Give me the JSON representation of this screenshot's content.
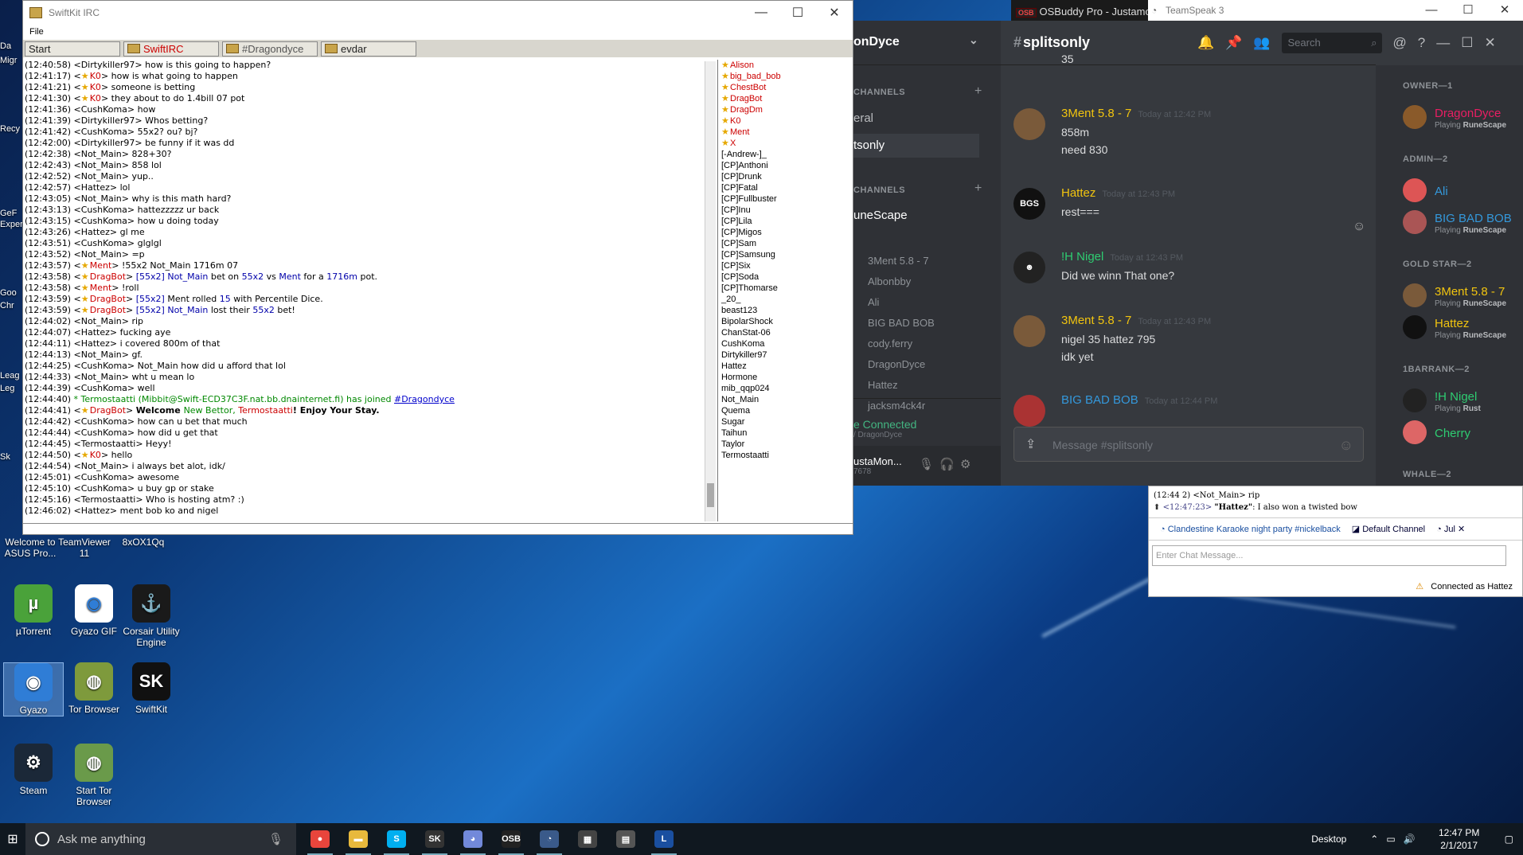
{
  "desktop": {
    "icons": [
      {
        "name": "µTorrent",
        "glyph": "µ",
        "color": "#4aa23a"
      },
      {
        "name": "Gyazo GIF",
        "glyph": "◉",
        "color": "#ffffff"
      },
      {
        "name": "Corsair Utility Engine",
        "glyph": "⚓",
        "color": "#1a1a1a"
      },
      {
        "name": "Gyazo",
        "glyph": "◉",
        "color": "#2f7dd6"
      },
      {
        "name": "Tor Browser",
        "glyph": "◍",
        "color": "#7e9a3c"
      },
      {
        "name": "SwiftKit",
        "glyph": "SK",
        "color": "#111111"
      },
      {
        "name": "Steam",
        "glyph": "⚙",
        "color": "#1b2838"
      },
      {
        "name": "Start Tor Browser",
        "glyph": "◍",
        "color": "#6a9a4a"
      }
    ],
    "top_icons": [
      "Welcome to ASUS Pro...",
      "TeamViewer 11",
      "8xOX1Qq"
    ],
    "edge_labels": [
      "Da",
      "Migr",
      "Recy",
      "GeF",
      "Exper",
      "Goo",
      "Chr",
      "Leag",
      "Leg",
      "Sk"
    ]
  },
  "irc": {
    "title": "SwiftKit IRC",
    "menu": "File",
    "tabs": [
      "Start",
      "SwiftIRC",
      "#Dragondyce",
      "evdar"
    ],
    "lines": [
      {
        "t": "(12:40:58)",
        "parts": [
          {
            "s": "<Dirtykiller97> how is this going to happen?"
          }
        ]
      },
      {
        "t": "(12:41:17)",
        "parts": [
          {
            "s": "<"
          },
          {
            "star": true
          },
          {
            "s": "K0",
            "c": "red"
          },
          {
            "s": "> how is what going to happen"
          }
        ]
      },
      {
        "t": "(12:41:21)",
        "parts": [
          {
            "s": "<"
          },
          {
            "star": true
          },
          {
            "s": "K0",
            "c": "red"
          },
          {
            "s": "> someone is betting"
          }
        ]
      },
      {
        "t": "(12:41:30)",
        "parts": [
          {
            "s": "<"
          },
          {
            "star": true
          },
          {
            "s": "K0",
            "c": "red"
          },
          {
            "s": "> they about to do 1.4bill 07 pot"
          }
        ]
      },
      {
        "t": "(12:41:36)",
        "parts": [
          {
            "s": "<CushKoma> how"
          }
        ]
      },
      {
        "t": "(12:41:39)",
        "parts": [
          {
            "s": "<Dirtykiller97> Whos betting?"
          }
        ]
      },
      {
        "t": "(12:41:42)",
        "parts": [
          {
            "s": "<CushKoma> 55x2? ou? bj?"
          }
        ]
      },
      {
        "t": "(12:42:00)",
        "parts": [
          {
            "s": "<Dirtykiller97> be funny if it was dd"
          }
        ]
      },
      {
        "t": "(12:42:38)",
        "parts": [
          {
            "s": "<Not_Main> 828+30?"
          }
        ]
      },
      {
        "t": "(12:42:43)",
        "parts": [
          {
            "s": "<Not_Main> 858 lol"
          }
        ]
      },
      {
        "t": "(12:42:52)",
        "parts": [
          {
            "s": "<Not_Main> yup.."
          }
        ]
      },
      {
        "t": "(12:42:57)",
        "parts": [
          {
            "s": "<Hattez> lol"
          }
        ]
      },
      {
        "t": "(12:43:05)",
        "parts": [
          {
            "s": "<Not_Main> why is this math hard?"
          }
        ]
      },
      {
        "t": "(12:43:13)",
        "parts": [
          {
            "s": "<CushKoma> hattezzzzz ur back"
          }
        ]
      },
      {
        "t": "(12:43:15)",
        "parts": [
          {
            "s": "<CushKoma> how u doing today"
          }
        ]
      },
      {
        "t": "(12:43:26)",
        "parts": [
          {
            "s": "<Hattez> gl me"
          }
        ]
      },
      {
        "t": "(12:43:51)",
        "parts": [
          {
            "s": "<CushKoma> glglgl"
          }
        ]
      },
      {
        "t": "(12:43:52)",
        "parts": [
          {
            "s": "<Not_Main> =p"
          }
        ]
      },
      {
        "t": "(12:43:57)",
        "parts": [
          {
            "s": "<"
          },
          {
            "star": true
          },
          {
            "s": "Ment",
            "c": "red"
          },
          {
            "s": "> !55x2 Not_Main 1716m 07"
          }
        ]
      },
      {
        "t": "(12:43:58)",
        "parts": [
          {
            "s": "<"
          },
          {
            "star": true
          },
          {
            "s": "DragBot",
            "c": "red"
          },
          {
            "s": "> "
          },
          {
            "s": "[55x2]",
            "c": "blue"
          },
          {
            "s": " "
          },
          {
            "s": "Not_Main",
            "c": "blue"
          },
          {
            "s": " bet on "
          },
          {
            "s": "55x2",
            "c": "blue"
          },
          {
            "s": " vs "
          },
          {
            "s": "Ment",
            "c": "blue"
          },
          {
            "s": " for a "
          },
          {
            "s": "1716m",
            "c": "blue"
          },
          {
            "s": " pot."
          }
        ]
      },
      {
        "t": "(12:43:58)",
        "parts": [
          {
            "s": "<"
          },
          {
            "star": true
          },
          {
            "s": "Ment",
            "c": "red"
          },
          {
            "s": "> !roll"
          }
        ]
      },
      {
        "t": "(12:43:59)",
        "parts": [
          {
            "s": "<"
          },
          {
            "star": true
          },
          {
            "s": "DragBot",
            "c": "red"
          },
          {
            "s": "> "
          },
          {
            "s": "[55x2]",
            "c": "blue"
          },
          {
            "s": " Ment rolled "
          },
          {
            "s": "15",
            "c": "blue"
          },
          {
            "s": " with Percentile Dice."
          }
        ]
      },
      {
        "t": "(12:43:59)",
        "parts": [
          {
            "s": "<"
          },
          {
            "star": true
          },
          {
            "s": "DragBot",
            "c": "red"
          },
          {
            "s": "> "
          },
          {
            "s": "[55x2]",
            "c": "blue"
          },
          {
            "s": " "
          },
          {
            "s": "Not_Main",
            "c": "blue"
          },
          {
            "s": " lost their "
          },
          {
            "s": "55x2",
            "c": "blue"
          },
          {
            "s": " bet!"
          }
        ]
      },
      {
        "t": "(12:44:02)",
        "parts": [
          {
            "s": "<Not_Main> rip"
          }
        ]
      },
      {
        "t": "(12:44:07)",
        "parts": [
          {
            "s": "<Hattez> fucking aye"
          }
        ]
      },
      {
        "t": "(12:44:11)",
        "parts": [
          {
            "s": "<Hattez> i covered 800m of that"
          }
        ]
      },
      {
        "t": "(12:44:13)",
        "parts": [
          {
            "s": "<Not_Main> gf."
          }
        ]
      },
      {
        "t": "(12:44:25)",
        "parts": [
          {
            "s": "<CushKoma> Not_Main how did u afford that lol"
          }
        ]
      },
      {
        "t": "(12:44:33)",
        "parts": [
          {
            "s": "<Not_Main> wht u mean lo"
          }
        ]
      },
      {
        "t": "(12:44:39)",
        "parts": [
          {
            "s": "<CushKoma> well"
          }
        ]
      },
      {
        "t": "(12:44:40)",
        "c": "grn",
        "parts": [
          {
            "s": "* Termostaatti (Mibbit@Swift-ECD37C3F.nat.bb.dnainternet.fi) has joined ",
            "c": "grn"
          },
          {
            "s": "#Dragondyce",
            "c": "lnk"
          }
        ]
      },
      {
        "t": "(12:44:41)",
        "parts": [
          {
            "s": "<"
          },
          {
            "star": true
          },
          {
            "s": "DragBot",
            "c": "red"
          },
          {
            "s": "> "
          },
          {
            "s": "Welcome ",
            "c": "bold"
          },
          {
            "s": "New Bettor, ",
            "c": "grn"
          },
          {
            "s": "Termostaatti",
            "c": "red"
          },
          {
            "s": "! Enjoy Your Stay.",
            "c": "bold"
          }
        ]
      },
      {
        "t": "(12:44:42)",
        "parts": [
          {
            "s": "<CushKoma> how can u bet that much"
          }
        ]
      },
      {
        "t": "(12:44:44)",
        "parts": [
          {
            "s": "<CushKoma> how did u get that"
          }
        ]
      },
      {
        "t": "(12:44:45)",
        "parts": [
          {
            "s": "<Termostaatti> Heyy!"
          }
        ]
      },
      {
        "t": "(12:44:50)",
        "parts": [
          {
            "s": "<"
          },
          {
            "star": true
          },
          {
            "s": "K0",
            "c": "red"
          },
          {
            "s": ">  hello"
          }
        ]
      },
      {
        "t": "(12:44:54)",
        "parts": [
          {
            "s": "<Not_Main> i always bet alot, idk/"
          }
        ]
      },
      {
        "t": "(12:45:01)",
        "parts": [
          {
            "s": "<CushKoma> awesome"
          }
        ]
      },
      {
        "t": "(12:45:10)",
        "parts": [
          {
            "s": "<CushKoma> u buy gp or stake"
          }
        ]
      },
      {
        "t": "(12:45:16)",
        "parts": [
          {
            "s": "<Termostaatti> Who is hosting atm? :)"
          }
        ]
      },
      {
        "t": "(12:46:02)",
        "parts": [
          {
            "s": "<Hattez> ment bob ko and nigel"
          }
        ]
      }
    ],
    "nicks_ops": [
      "Alison",
      "big_bad_bob",
      "ChestBot",
      "DragBot",
      "DragDm",
      "K0",
      "Ment",
      "X"
    ],
    "nicks": [
      "[-Andrew-]_",
      "[CP]Anthoni",
      "[CP]Drunk",
      "[CP]Fatal",
      "[CP]Fullbuster",
      "[CP]Inu",
      "[CP]Lila",
      "[CP]Migos",
      "[CP]Sam",
      "[CP]Samsung",
      "[CP]Six",
      "[CP]Soda",
      "[CP]Thomarse",
      "_20_",
      "beast123",
      "BipolarShock",
      "ChanStat-06",
      "CushKoma",
      "Dirtykiller97",
      "Hattez",
      "Hormone",
      "mib_qqp024",
      "Not_Main",
      "Quema",
      "Sugar",
      "Taihun",
      "Taylor",
      "Termostaatti"
    ]
  },
  "osbuddy": {
    "badge": "OSB",
    "title": "OSBuddy Pro - Justamo"
  },
  "teamspeak": {
    "title": "TeamSpeak 3",
    "chat_line1": "(12:44  2) <Not_Main> rip",
    "chat_line2_time": "<12:47:23>",
    "chat_line2_name": "\"Hattez\"",
    "chat_line2_text": ": I also won a twisted bow",
    "tab1": "Clandestine Karaoke night party #nickelback",
    "tab2": "Default Channel",
    "tab3": "Jul",
    "placeholder": "Enter Chat Message...",
    "status": "Connected as Hattez"
  },
  "discord": {
    "server": "onDyce",
    "channel": "splitsonly",
    "search_placeholder": "Search",
    "text_cat": "CHANNELS",
    "channels": [
      "eral",
      "tsonly"
    ],
    "voice_cat": "CHANNELS",
    "voice_channel": "uneScape",
    "voice_users": [
      "3Ment 5.8 - 7",
      "Albonbby",
      "Ali",
      "BIG BAD BOB",
      "cody.ferry",
      "DragonDyce",
      "Hattez",
      "jacksm4ck4r"
    ],
    "connected": "e Connected",
    "connected_sub": "/ DragonDyce",
    "user": "ustaMon...",
    "user_tag": "7678",
    "first_line": "35",
    "messages": [
      {
        "name": "3Ment 5.8 - 7",
        "color": "#f1c40f",
        "time": "Today at 12:42 PM",
        "lines": [
          "858m",
          "need 830"
        ],
        "av": "#7a5a3a",
        "avt": ""
      },
      {
        "name": "Hattez",
        "color": "#f1c40f",
        "time": "Today at 12:43 PM",
        "lines": [
          "rest==="
        ],
        "av": "#111",
        "avt": "BGS"
      },
      {
        "name": "!H Nigel",
        "color": "#2ecc71",
        "time": "Today at 12:43 PM",
        "lines": [
          "Did we winn That one?"
        ],
        "av": "#222",
        "avt": "☻"
      },
      {
        "name": "3Ment 5.8 - 7",
        "color": "#f1c40f",
        "time": "Today at 12:43 PM",
        "lines": [
          "nigel 35 hattez 795",
          "idk yet"
        ],
        "av": "#7a5a3a",
        "avt": ""
      },
      {
        "name": "BIG BAD BOB",
        "color": "#3498db",
        "time": "Today at 12:44 PM",
        "lines": [],
        "av": "#a33",
        "avt": ""
      }
    ],
    "input_placeholder": "Message #splitsonly",
    "groups": [
      {
        "cat": "OWNER—1",
        "members": [
          {
            "name": "DragonDyce",
            "color": "#e91e63",
            "playing": "RuneScape",
            "av": "#8a5a2a"
          }
        ]
      },
      {
        "cat": "ADMIN—2",
        "members": [
          {
            "name": "Ali",
            "color": "#3498db",
            "playing": "",
            "av": "#d55"
          },
          {
            "name": "BIG BAD BOB",
            "color": "#3498db",
            "playing": "RuneScape",
            "av": "#a55"
          }
        ]
      },
      {
        "cat": "GOLD STAR—2",
        "members": [
          {
            "name": "3Ment 5.8 - 7",
            "color": "#f1c40f",
            "playing": "RuneScape",
            "av": "#7a5a3a"
          },
          {
            "name": "Hattez",
            "color": "#f1c40f",
            "playing": "RuneScape",
            "av": "#111"
          }
        ]
      },
      {
        "cat": "1BARRANK—2",
        "members": [
          {
            "name": "!H Nigel",
            "color": "#2ecc71",
            "playing": "Rust",
            "av": "#222"
          },
          {
            "name": "Cherry",
            "color": "#2ecc71",
            "playing": "",
            "av": "#d66"
          }
        ]
      },
      {
        "cat": "WHALE—2",
        "members": []
      }
    ],
    "playing_prefix": "Playing"
  },
  "taskbar": {
    "search": "Ask me anything",
    "desktop_label": "Desktop",
    "time": "12:47 PM",
    "date": "2/1/2017",
    "apps": [
      {
        "name": "chrome",
        "g": "●",
        "c": "#e8453c"
      },
      {
        "name": "explorer",
        "g": "▬",
        "c": "#e8b93c"
      },
      {
        "name": "skype",
        "g": "S",
        "c": "#00aff0"
      },
      {
        "name": "swiftkit",
        "g": "SK",
        "c": "#333"
      },
      {
        "name": "discord",
        "g": "◕",
        "c": "#7289da"
      },
      {
        "name": "osbuddy",
        "g": "OSB",
        "c": "#222"
      },
      {
        "name": "teamspeak",
        "g": "◔",
        "c": "#3a5a8a"
      },
      {
        "name": "grid-app",
        "g": "▦",
        "c": "#444"
      },
      {
        "name": "calculator",
        "g": "▤",
        "c": "#555"
      },
      {
        "name": "league",
        "g": "L",
        "c": "#1a4fa0"
      }
    ]
  }
}
